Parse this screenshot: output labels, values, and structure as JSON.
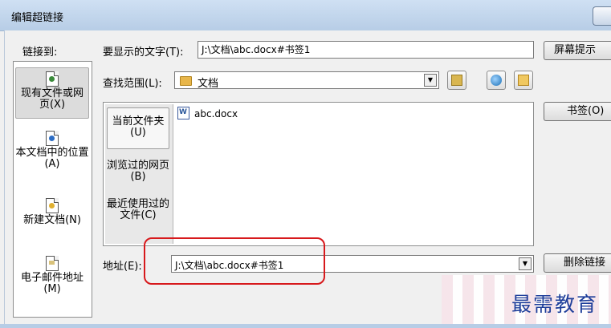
{
  "window": {
    "title": "编辑超链接"
  },
  "link_to": {
    "label": "链接到:",
    "items": [
      {
        "label": "现有文件或网页(X)",
        "icon": "web-page-icon"
      },
      {
        "label": "本文档中的位置(A)",
        "icon": "document-place-icon"
      },
      {
        "label": "新建文档(N)",
        "icon": "new-document-icon"
      },
      {
        "label": "电子邮件地址(M)",
        "icon": "email-icon"
      }
    ]
  },
  "display_text": {
    "label": "要显示的文字(T):",
    "value": "J:\\文档\\abc.docx#书签1"
  },
  "screen_tip_button": "屏幕提示",
  "look_in": {
    "label": "查找范围(L):",
    "value": "文档"
  },
  "places": [
    {
      "label": "当前文件夹(U)"
    },
    {
      "label": "浏览过的网页(B)"
    },
    {
      "label": "最近使用过的文件(C)"
    }
  ],
  "files": [
    {
      "name": "abc.docx"
    }
  ],
  "bookmark_button": "书签(O)",
  "address": {
    "label": "地址(E):",
    "value": "J:\\文档\\abc.docx#书签1"
  },
  "remove_link_button": "删除链接",
  "watermark": "最需教育",
  "colors": {
    "highlight": "#d7191c",
    "watermark_text": "#1e3e9a",
    "title_bar": "#cfe0f3"
  }
}
